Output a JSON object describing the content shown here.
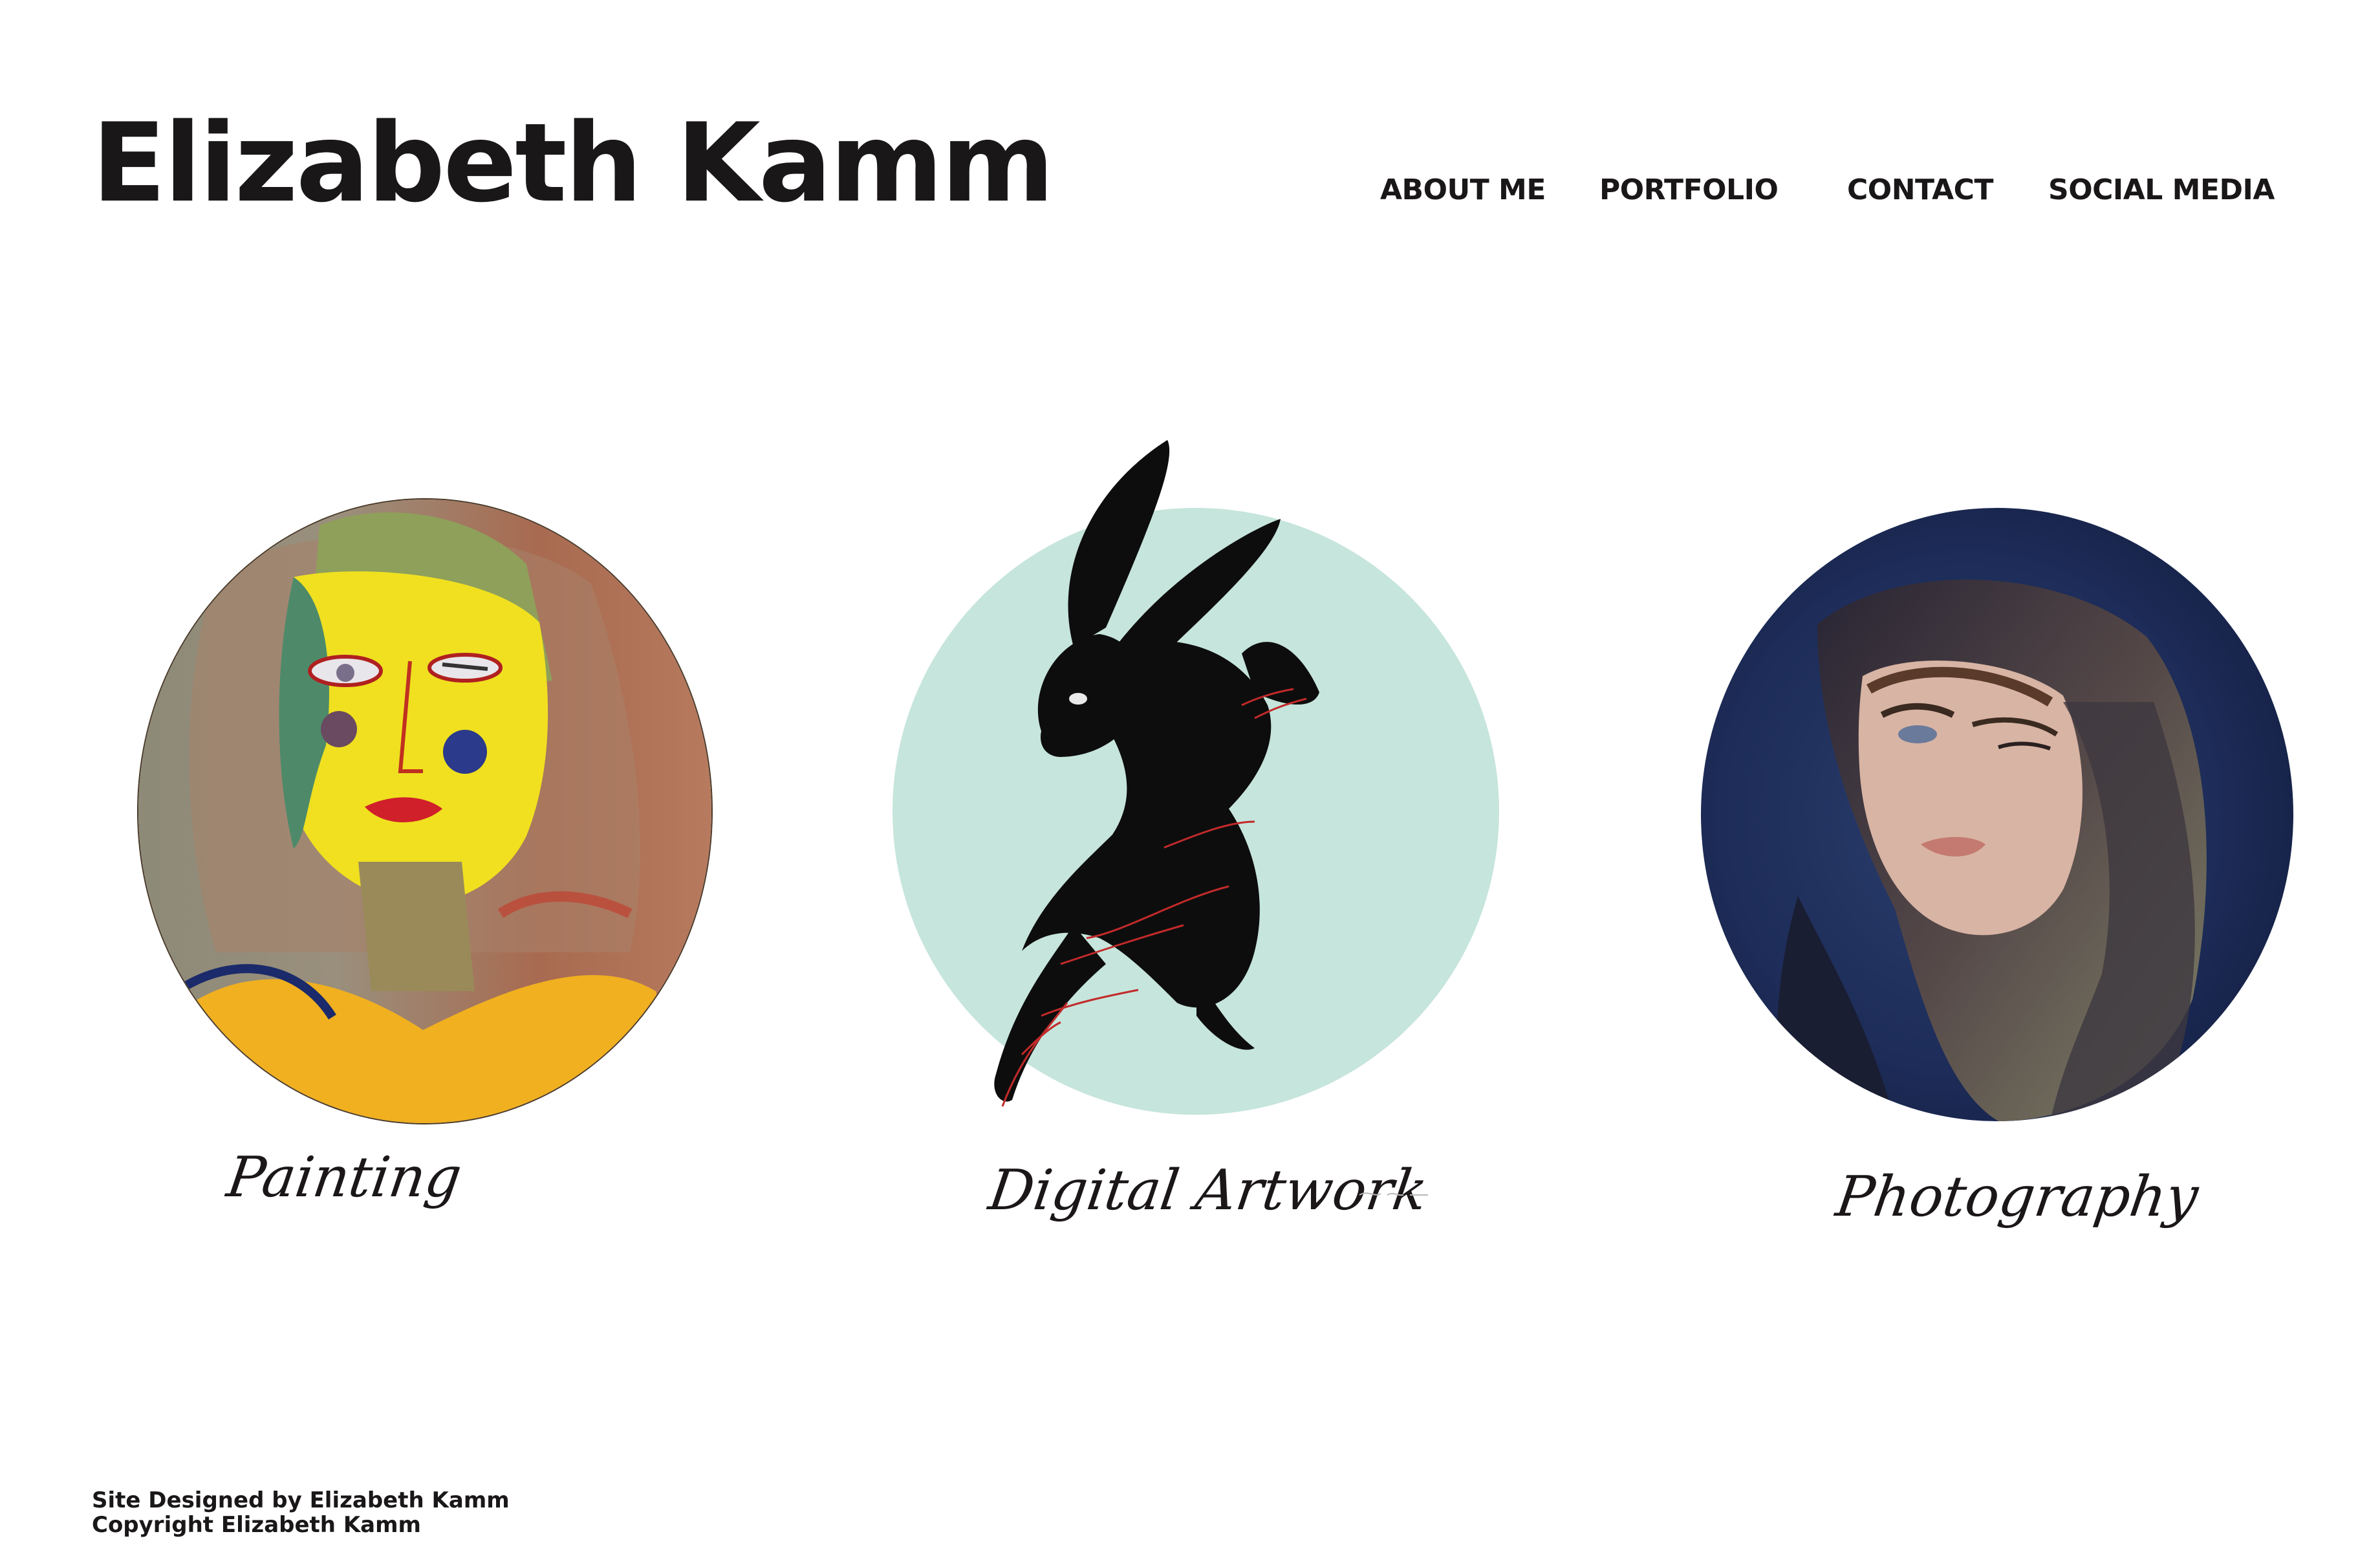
{
  "header": {
    "site_title": "Elizabeth Kamm"
  },
  "nav": {
    "items": [
      "ABOUT ME",
      "PORTFOLIO",
      "CONTACT",
      "SOCIAL MEDIA"
    ]
  },
  "gallery": {
    "cards": [
      {
        "label": "Painting",
        "image": "abstract-portrait-painting"
      },
      {
        "label": "Digital Artwork",
        "image": "black-rabbit-illustration"
      },
      {
        "label": "Photography",
        "image": "portrait-photograph"
      }
    ]
  },
  "footer": {
    "line1": "Site Designed by Elizabeth Kamm",
    "line2": "Copyright Elizabeth Kamm"
  },
  "colors": {
    "text": "#1a1718",
    "digital_circle": "#c6e5dc",
    "photo_background": "#1a2a55"
  }
}
